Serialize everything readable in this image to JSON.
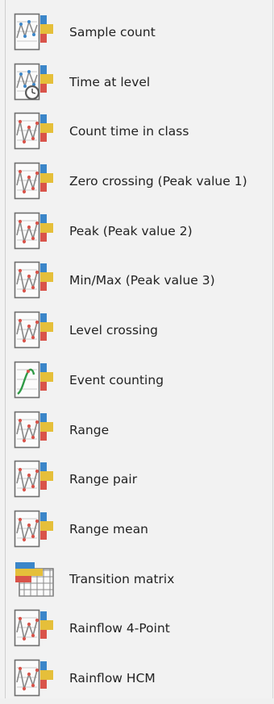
{
  "colors": {
    "blue": "#3b86c9",
    "yellow": "#e5bf3a",
    "red": "#d9534a",
    "green": "#2f9a46",
    "frame": "#6f6f6f"
  },
  "items": [
    {
      "label": "Sample count",
      "icon": "sample-count-icon"
    },
    {
      "label": "Time at level",
      "icon": "time-at-level-icon"
    },
    {
      "label": "Count time in class",
      "icon": "count-time-in-class-icon"
    },
    {
      "label": "Zero crossing (Peak value 1)",
      "icon": "zero-crossing-icon"
    },
    {
      "label": "Peak (Peak value 2)",
      "icon": "peak-icon"
    },
    {
      "label": "Min/Max (Peak value 3)",
      "icon": "min-max-icon"
    },
    {
      "label": "Level crossing",
      "icon": "level-crossing-icon"
    },
    {
      "label": "Event counting",
      "icon": "event-counting-icon"
    },
    {
      "label": "Range",
      "icon": "range-icon"
    },
    {
      "label": "Range pair",
      "icon": "range-pair-icon"
    },
    {
      "label": "Range mean",
      "icon": "range-mean-icon"
    },
    {
      "label": "Transition matrix",
      "icon": "transition-matrix-icon"
    },
    {
      "label": "Rainflow 4-Point",
      "icon": "rainflow-4-point-icon"
    },
    {
      "label": "Rainflow HCM",
      "icon": "rainflow-hcm-icon"
    }
  ]
}
